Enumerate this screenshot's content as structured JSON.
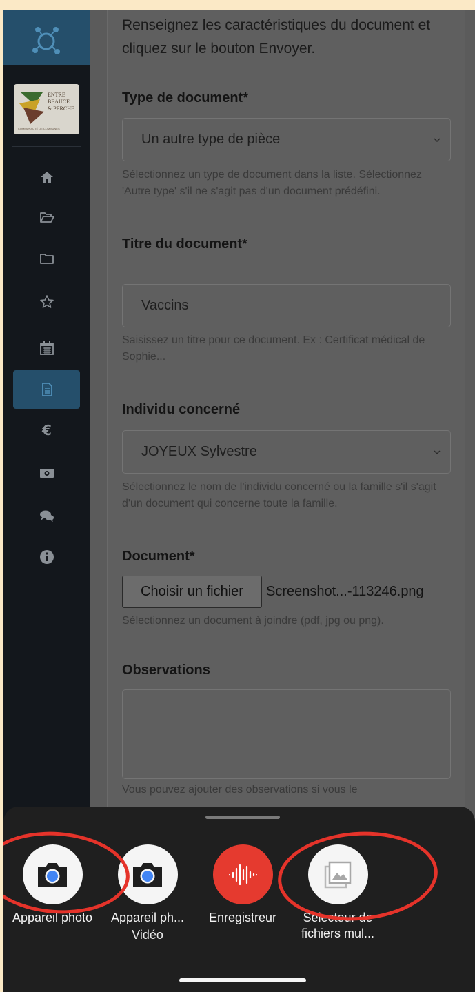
{
  "sidebar": {
    "logo_text": [
      "ENTRE",
      "BEAUCE",
      "& PERCHE",
      "COMMUNAUTÉ DE COMMUNES"
    ],
    "items": [
      {
        "name": "home-icon",
        "active": false
      },
      {
        "name": "folder-open-icon",
        "active": false
      },
      {
        "name": "folder-icon",
        "active": false
      },
      {
        "name": "star-icon",
        "active": false
      },
      {
        "name": "calendar-icon",
        "active": false
      },
      {
        "name": "document-icon",
        "active": true
      },
      {
        "name": "euro-icon",
        "active": false
      },
      {
        "name": "money-icon",
        "active": false
      },
      {
        "name": "comments-icon",
        "active": false
      },
      {
        "name": "info-icon",
        "active": false
      }
    ]
  },
  "form": {
    "intro": "Renseignez les caractéristiques du document et cliquez sur le bouton Envoyer.",
    "type_label": "Type de document*",
    "type_value": "Un autre type de pièce",
    "type_help": "Sélectionnez un type de document dans la liste. Sélectionnez 'Autre type' s'il ne s'agit pas d'un document prédéfini.",
    "title_label": "Titre du document*",
    "title_value": "Vaccins",
    "title_help": "Saisissez un titre pour ce document. Ex : Certificat médical de Sophie...",
    "person_label": "Individu concerné",
    "person_value": "JOYEUX Sylvestre",
    "person_help": "Sélectionnez le nom de l'individu concerné ou la famille s'il s'agit d'un document qui concerne toute la famille.",
    "document_label": "Document*",
    "choose_file_button": "Choisir un fichier",
    "file_name": "Screenshot...-113246.png",
    "document_help": "Sélectionnez un document à joindre (pdf, jpg ou png).",
    "observations_label": "Observations",
    "observations_value": "",
    "observations_help": "Vous pouvez ajouter des observations si vous le"
  },
  "sheet": {
    "apps": [
      {
        "label": "Appareil photo",
        "sub": "",
        "icon": "camera-icon"
      },
      {
        "label": "Appareil ph...",
        "sub": "Vidéo",
        "icon": "camera-icon"
      },
      {
        "label": "Enregistreur",
        "sub": "",
        "icon": "recorder-icon"
      },
      {
        "label": "Sélecteur de fichiers mul...",
        "sub": "",
        "icon": "gallery-icon"
      }
    ]
  },
  "colors": {
    "page_background": "#fbe9c6",
    "sidebar": "#13171c",
    "sidebar_active": "#254f6b",
    "sheet": "#1f1f1f",
    "recorder": "#e53a2f",
    "annotation": "#e5332a"
  }
}
